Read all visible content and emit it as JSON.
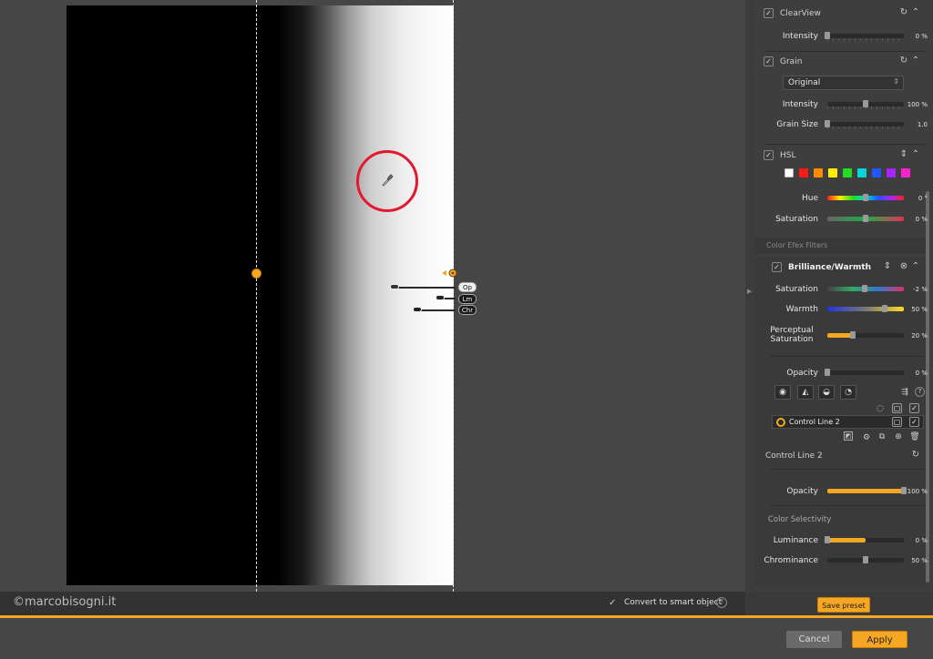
{
  "watermark": "©marcobisogni.it",
  "smart_object": {
    "checked": true,
    "label": "Convert to smart object",
    "help_icon": "help-icon"
  },
  "control_line_labels": {
    "opacity": "Op",
    "luminance": "Lm",
    "chrominance": "Chr"
  },
  "clearview": {
    "enabled": true,
    "title": "ClearView",
    "intensity_label": "Intensity",
    "intensity_value": "0 %",
    "intensity": 0
  },
  "grain": {
    "enabled": true,
    "title": "Grain",
    "preset": "Original",
    "intensity_label": "Intensity",
    "intensity_value": "100 %",
    "intensity": 1.0,
    "size_label": "Grain Size",
    "size_value": "1.0",
    "size": 0.0
  },
  "hsl": {
    "enabled": true,
    "title": "HSL",
    "swatches": [
      "#ffffff",
      "#ff1a1a",
      "#ff8c00",
      "#ffee00",
      "#22dd22",
      "#00d8d8",
      "#2255ff",
      "#aa22ff",
      "#ff22cc"
    ],
    "hue_label": "Hue",
    "hue_value": "0 °",
    "hue": 0.5,
    "saturation_label": "Saturation",
    "saturation_value": "0 %",
    "saturation": 0.5
  },
  "color_efex_header": "Color Efex Filters",
  "brilliance": {
    "enabled": true,
    "title": "Brilliance/Warmth",
    "saturation_label": "Saturation",
    "saturation_value": "-2 %",
    "saturation": 0.49,
    "warmth_label": "Warmth",
    "warmth_value": "50 %",
    "warmth": 0.75,
    "perceptual_label_1": "Perceptual",
    "perceptual_label_2": "Saturation",
    "perceptual_value": "20 %",
    "perceptual": 0.33,
    "opacity_label": "Opacity",
    "opacity_value": "0 %",
    "opacity": 0.0
  },
  "control_line_item": {
    "name": "Control Line 2",
    "visible": true,
    "checked": true
  },
  "control_line_settings": {
    "title": "Control Line 2",
    "opacity_label": "Opacity",
    "opacity_value": "100 %",
    "opacity": 1.0,
    "color_selectivity_label": "Color Selectivity",
    "luminance_label": "Luminance",
    "luminance_value": "0 %",
    "luminance": 0.5,
    "chrominance_label": "Chrominance",
    "chrominance_value": "50 %",
    "chrominance": 0.5
  },
  "save_preset_label": "Save preset",
  "footer": {
    "cancel_label": "Cancel",
    "apply_label": "Apply"
  },
  "colors": {
    "accent": "#f5a623",
    "cursor_ring": "#e3182f",
    "panel_bg": "#3e3e3e",
    "canvas_bg": "#464646"
  }
}
